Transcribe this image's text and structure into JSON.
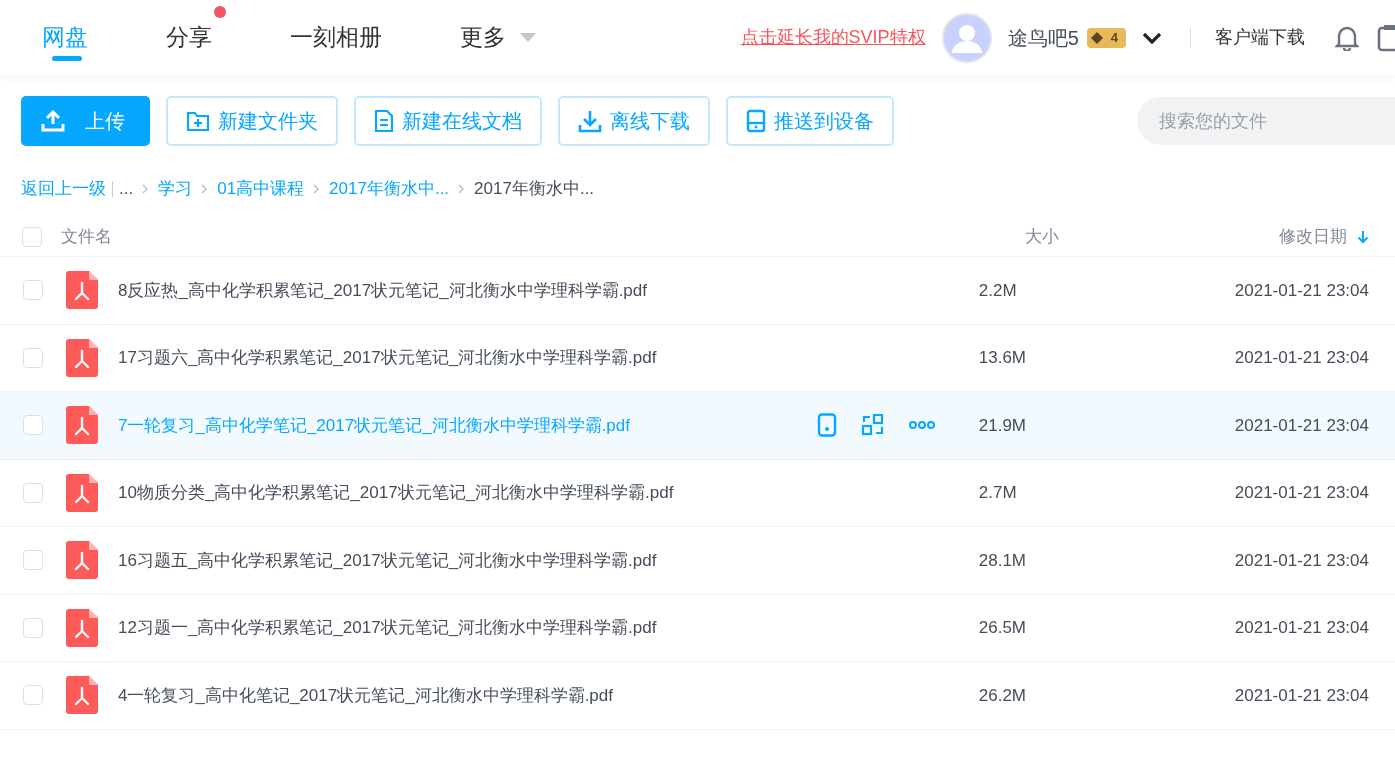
{
  "nav": {
    "tabs": [
      {
        "label": "网盘",
        "selected": true,
        "dot": false,
        "caret": false
      },
      {
        "label": "分享",
        "selected": false,
        "dot": true,
        "caret": false
      },
      {
        "label": "一刻相册",
        "selected": false,
        "dot": false,
        "caret": false
      },
      {
        "label": "更多",
        "selected": false,
        "dot": false,
        "caret": true
      }
    ],
    "promo_link": "点击延长我的SVIP特权",
    "username": "途鸟吧5",
    "vip_level": "4",
    "client_download": "客户端下载"
  },
  "toolbar": {
    "buttons": [
      {
        "kind": "upload",
        "label": "上传",
        "primary": true
      },
      {
        "kind": "folder",
        "label": "新建文件夹",
        "primary": false
      },
      {
        "kind": "doc",
        "label": "新建在线文档",
        "primary": false
      },
      {
        "kind": "download",
        "label": "离线下载",
        "primary": false
      },
      {
        "kind": "device",
        "label": "推送到设备",
        "primary": false
      }
    ],
    "search": {
      "placeholder": "搜索您的文件"
    }
  },
  "breadcrumb": {
    "back": "返回上一级",
    "items": [
      {
        "label": "...",
        "link": false
      },
      {
        "label": "学习",
        "link": true
      },
      {
        "label": "01高中课程",
        "link": true
      },
      {
        "label": "2017年衡水中...",
        "link": true
      },
      {
        "label": "2017年衡水中...",
        "link": false
      }
    ]
  },
  "table": {
    "columns": [
      "文件名",
      "大小",
      "修改日期"
    ],
    "select_all": false,
    "rows": [
      {
        "name": "8反应热_高中化学积累笔记_2017状元笔记_河北衡水中学理科学霸.pdf",
        "size": "2.2M",
        "date": "2021-01-21 23:04",
        "checked": false,
        "hovered": false
      },
      {
        "name": "17习题六_高中化学积累笔记_2017状元笔记_河北衡水中学理科学霸.pdf",
        "size": "13.6M",
        "date": "2021-01-21 23:04",
        "checked": false,
        "hovered": false
      },
      {
        "name": "7一轮复习_高中化学笔记_2017状元笔记_河北衡水中学理科学霸.pdf",
        "size": "21.9M",
        "date": "2021-01-21 23:04",
        "checked": false,
        "hovered": true
      },
      {
        "name": "10物质分类_高中化学积累笔记_2017状元笔记_河北衡水中学理科学霸.pdf",
        "size": "2.7M",
        "date": "2021-01-21 23:04",
        "checked": false,
        "hovered": false
      },
      {
        "name": "16习题五_高中化学积累笔记_2017状元笔记_河北衡水中学理科学霸.pdf",
        "size": "28.1M",
        "date": "2021-01-21 23:04",
        "checked": false,
        "hovered": false
      },
      {
        "name": "12习题一_高中化学积累笔记_2017状元笔记_河北衡水中学理科学霸.pdf",
        "size": "26.5M",
        "date": "2021-01-21 23:04",
        "checked": false,
        "hovered": false
      },
      {
        "name": "4一轮复习_高中化笔记_2017状元笔记_河北衡水中学理科学霸.pdf",
        "size": "26.2M",
        "date": "2021-01-21 23:04",
        "checked": false,
        "hovered": false
      }
    ]
  }
}
